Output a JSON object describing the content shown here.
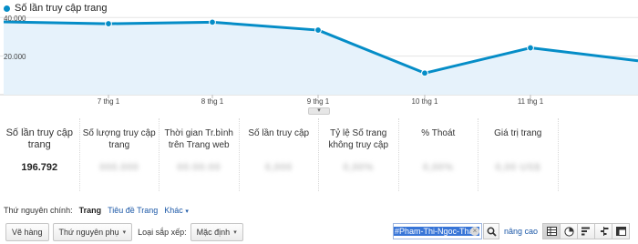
{
  "chart_data": {
    "type": "area",
    "series": [
      {
        "name": "Số lần truy cập trang",
        "values": [
          37800,
          36800,
          37600,
          33500,
          11200,
          24300,
          17600
        ]
      }
    ],
    "x_tick_labels": [
      "7 thg 1",
      "8 thg 1",
      "9 thg 1",
      "10 thg 1",
      "11 thg 1"
    ],
    "y_tick_labels": [
      "40.000",
      "20.000"
    ],
    "y_ticks": [
      40000,
      20000
    ],
    "ylim": [
      0,
      42500
    ],
    "grid": true,
    "legend_position": "top-left",
    "line_color": "#058dc7",
    "fill_color": "#e6f2fb"
  },
  "scorecards": [
    {
      "label": "Số lần truy cập trang",
      "value": "196.792",
      "blurred": false
    },
    {
      "label": "Số lượng truy cập trang",
      "value": "000.000",
      "blurred": true
    },
    {
      "label": "Thời gian Tr.bình trên Trang web",
      "value": "00:00:00",
      "blurred": true
    },
    {
      "label": "Số lần truy cập",
      "value": "0,000",
      "blurred": true
    },
    {
      "label": "Tỷ lệ Số trang không truy cập",
      "value": "0,00%",
      "blurred": true
    },
    {
      "label": "% Thoát",
      "value": "0,00%",
      "blurred": true
    },
    {
      "label": "Giá trị trang",
      "value": "0,00 US$",
      "blurred": true
    },
    {
      "label": "",
      "value": "",
      "blurred": true
    }
  ],
  "dimension": {
    "prefix": "Thứ nguyên chính:",
    "active": "Trang",
    "alt": "Tiêu đề Trang",
    "other": "Khác",
    "other_caret": "▾"
  },
  "toolbar": {
    "chart_button": "Vẽ hàng",
    "secondary_dimension": "Thứ nguyên phụ",
    "sort_label": "Loại sắp xếp:",
    "sort_value": "Mặc định",
    "caret": "▾",
    "search_value": "#Pham-Thi-Ngoc-Thao",
    "clear_icon": "×",
    "advanced_link": "nâng cao",
    "view_icons": [
      "table-icon",
      "pie-icon",
      "performance-icon",
      "comparison-icon",
      "pivot-icon"
    ]
  }
}
